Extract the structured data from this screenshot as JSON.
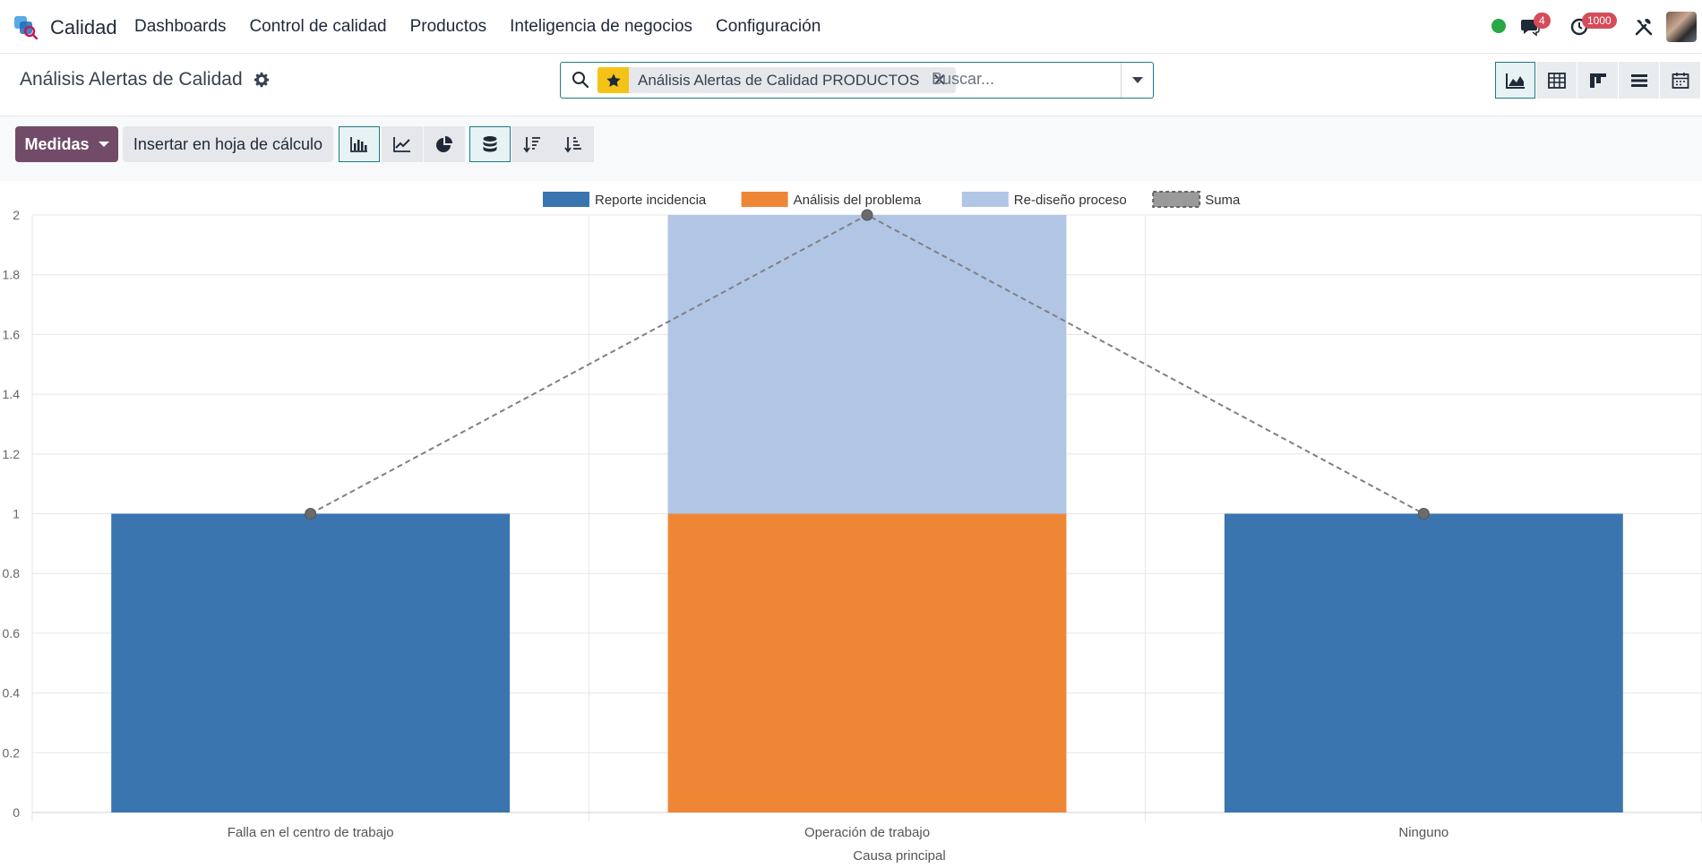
{
  "app": {
    "name": "Calidad",
    "menu": [
      "Dashboards",
      "Control de calidad",
      "Productos",
      "Inteligencia de negocios",
      "Configuración"
    ]
  },
  "systray": {
    "messages_count": "4",
    "activities_count": "1000",
    "presence_color": "#28a745"
  },
  "breadcrumb": {
    "title": "Análisis Alertas de Calidad"
  },
  "search": {
    "facet_label": "Análisis Alertas de Calidad PRODUCTOS",
    "placeholder": "Buscar..."
  },
  "view_switcher": {
    "views": [
      "graph-icon",
      "pivot-icon",
      "kanban-icon",
      "list-icon",
      "calendar-icon"
    ],
    "active": "graph-icon"
  },
  "toolbar": {
    "measures_label": "Medidas",
    "insert_label": "Insertar en hoja de cálculo",
    "chart_types": [
      "bar-chart-icon",
      "line-chart-icon",
      "pie-chart-icon"
    ],
    "active_chart_type": "bar-chart-icon",
    "stacked_active": true,
    "sort_buttons": [
      "sort-descending-icon",
      "sort-ascending-icon"
    ]
  },
  "colors": {
    "accent": "#714b67",
    "teal": "#1f7a84",
    "series1": "#3a75af",
    "series2": "#ef8636",
    "series3": "#b1c5e5",
    "sum": "#808080"
  },
  "chart_data": {
    "type": "bar",
    "stacked": true,
    "categories": [
      "Falla en el centro de trabajo",
      "Operación de trabajo",
      "Ninguno"
    ],
    "series": [
      {
        "name": "Reporte incidencia",
        "values": [
          1,
          0,
          1
        ],
        "color": "#3a75af"
      },
      {
        "name": "Análisis del problema",
        "values": [
          0,
          1,
          0
        ],
        "color": "#ef8636"
      },
      {
        "name": "Re-diseño proceso",
        "values": [
          0,
          1,
          0
        ],
        "color": "#b1c5e5"
      }
    ],
    "sum": {
      "name": "Suma",
      "values": [
        1,
        2,
        1
      ],
      "style": "dashed-line"
    },
    "xlabel": "Causa principal",
    "ylabel": "",
    "ylim": [
      0,
      2
    ],
    "yticks": [
      "0",
      "0.2",
      "0.4",
      "0.6",
      "0.8",
      "1",
      "1.2",
      "1.4",
      "1.6",
      "1.8",
      "2"
    ],
    "legend_position": "top-center",
    "grid": true
  }
}
